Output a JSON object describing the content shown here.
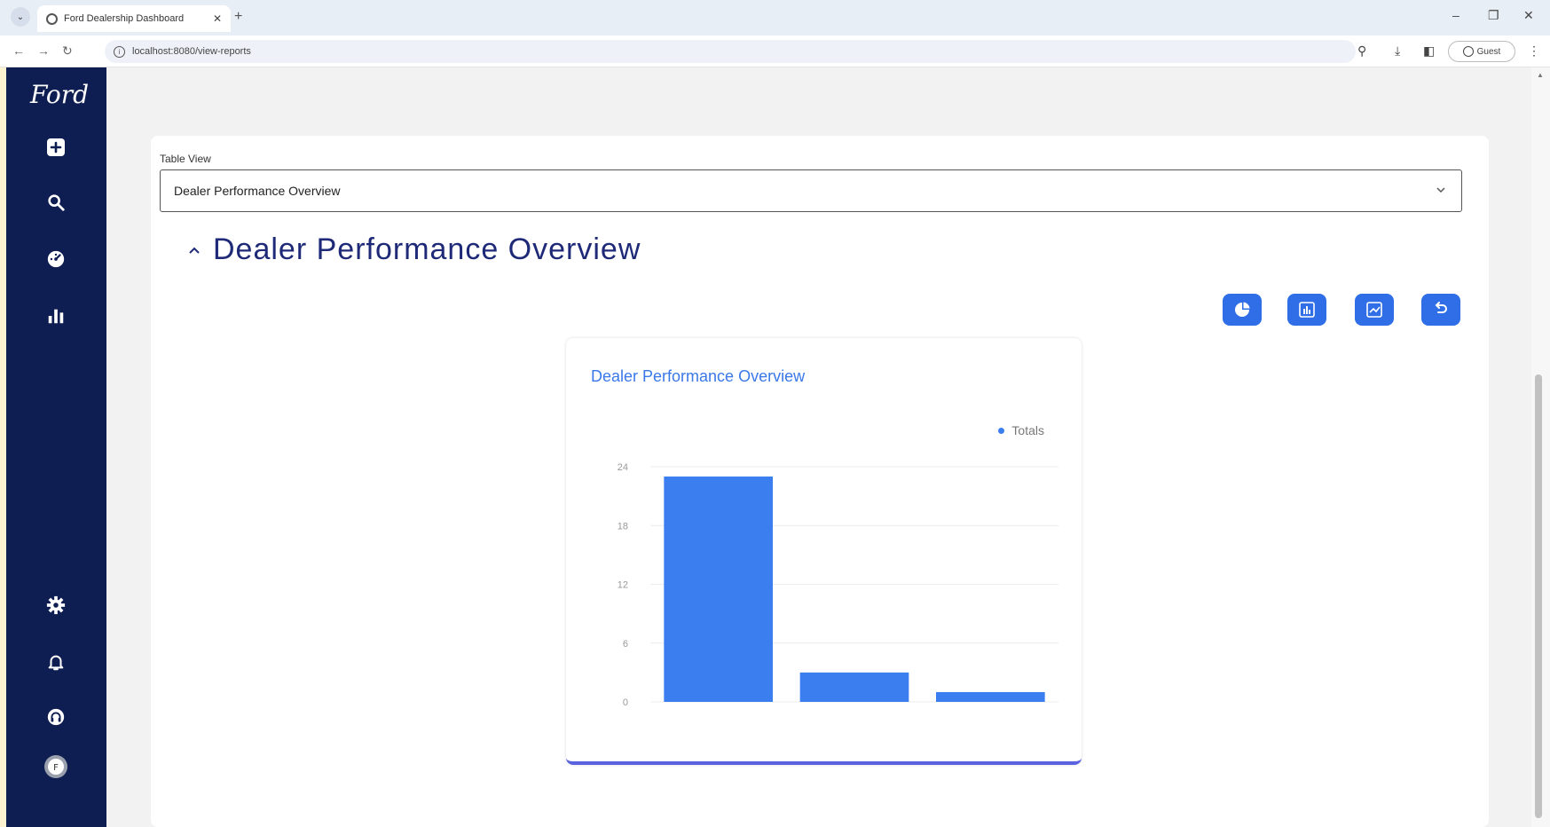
{
  "browser": {
    "tab_title": "Ford Dealership Dashboard",
    "url": "localhost:8080/view-reports",
    "guest_label": "Guest"
  },
  "sidebar": {
    "logo": "Ford",
    "icons": [
      "plus-square-icon",
      "search-icon",
      "dashboard-icon",
      "bar-chart-icon",
      "gear-icon",
      "bell-icon",
      "headset-icon",
      "avatar-icon"
    ]
  },
  "main": {
    "table_view_label": "Table View",
    "table_view_selected": "Dealer Performance Overview",
    "section_title": "Dealer Performance Overview",
    "actions": [
      "pie-chart-icon",
      "bar-chart-icon",
      "line-chart-icon",
      "undo-icon"
    ],
    "accent_color": "#2f6ee6"
  },
  "chart_data": {
    "type": "bar",
    "title": "Dealer Performance Overview",
    "series": [
      {
        "name": "Totals",
        "values": [
          23,
          3,
          1
        ]
      }
    ],
    "categories": [
      "",
      "",
      ""
    ],
    "yticks": [
      "0",
      "6",
      "12",
      "18",
      "24"
    ],
    "ylim": [
      0,
      24
    ],
    "grid": true,
    "legend": "top-right",
    "bar_color": "#3a7ef0"
  }
}
